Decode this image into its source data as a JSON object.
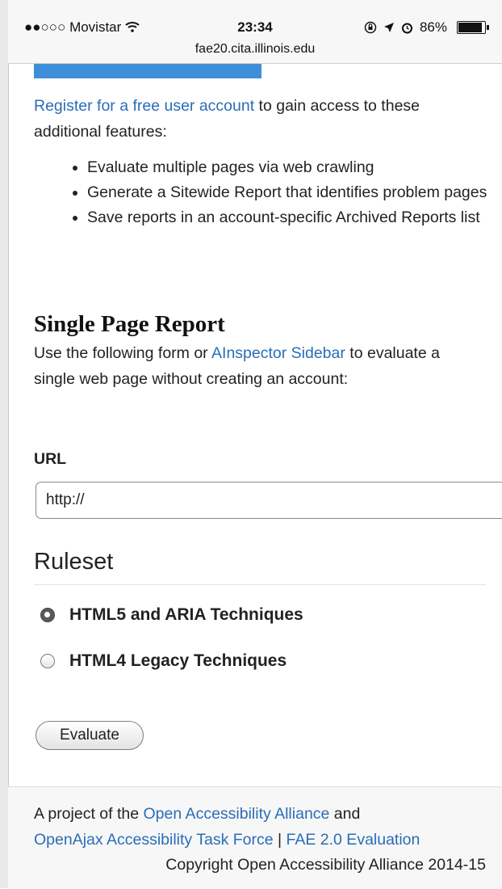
{
  "status_bar": {
    "carrier": "●●○○○ Movistar",
    "time": "23:34",
    "battery_label": "86%",
    "battery_level": 0.86,
    "url": "fae20.cita.illinois.edu"
  },
  "intro": {
    "register_link": "Register for a free user account",
    "text": " to gain access to these additional features:",
    "features": [
      "Evaluate multiple pages via web crawling",
      "Generate a Sitewide Report that identifies problem pages",
      "Save reports in an account-specific Archived Reports list"
    ]
  },
  "single_page": {
    "heading": "Single Page Report",
    "desc_before": "Use the following form or ",
    "sidebar_link": "AInspector Sidebar",
    "desc_after": " to evaluate a single web page without creating an account:"
  },
  "form": {
    "url_label": "URL",
    "url_value": "http://",
    "ruleset_title": "Ruleset",
    "options": [
      {
        "label": "HTML5 and ARIA Techniques",
        "checked": true
      },
      {
        "label": "HTML4 Legacy Techniques",
        "checked": false
      }
    ],
    "evaluate_label": "Evaluate"
  },
  "footer": {
    "text1": "A project of the ",
    "link1": "Open Accessibility Alliance",
    "text2": " and",
    "link2": "OpenAjax Accessibility Task Force",
    "sep": " | ",
    "link3": "FAE 2.0 Evaluation",
    "copyright": "Copyright Open Accessibility Alliance 2014-15"
  }
}
